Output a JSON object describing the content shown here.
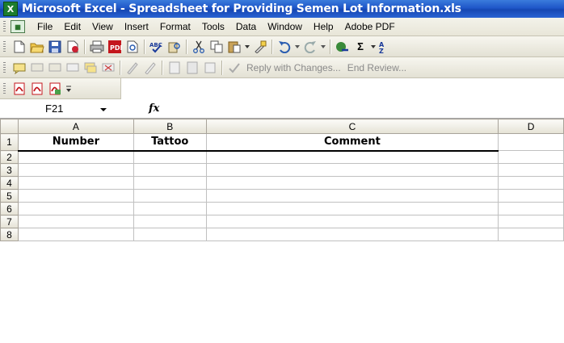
{
  "window": {
    "title": "Microsoft Excel - Spreadsheet for Providing Semen Lot Information.xls",
    "app_icon_letter": "X"
  },
  "menubar": {
    "items": [
      "File",
      "Edit",
      "View",
      "Insert",
      "Format",
      "Tools",
      "Data",
      "Window",
      "Help",
      "Adobe PDF"
    ]
  },
  "toolbar_standard": {
    "icons": [
      "new-icon",
      "open-icon",
      "save-icon",
      "permission-icon",
      "print-icon",
      "pdf-icon",
      "print-preview-icon",
      "spelling-icon",
      "research-icon",
      "cut-icon",
      "copy-icon",
      "paste-icon",
      "format-painter-icon",
      "undo-icon",
      "redo-icon",
      "hyperlink-icon",
      "autosum-icon",
      "sort-icon"
    ],
    "autosum_glyph": "Σ"
  },
  "toolbar_review": {
    "reply_label": "Reply with Changes...",
    "end_review_label": "End Review..."
  },
  "toolbar_pdf": {
    "icons": [
      "pdf-convert-icon",
      "pdf-email-icon",
      "pdf-review-icon"
    ]
  },
  "formula_bar": {
    "name_box": "F21",
    "fx": "fx",
    "value": ""
  },
  "sheet": {
    "columns": [
      "A",
      "B",
      "C",
      "D"
    ],
    "rows": [
      "1",
      "2",
      "3",
      "4",
      "5",
      "6",
      "7",
      "8"
    ],
    "header_cells": [
      "Number",
      "Tattoo",
      "Comment"
    ]
  },
  "colors": {
    "titlebar": "#1f56c8",
    "toolbar": "#ece9d8",
    "grid": "#c0c0c0"
  }
}
